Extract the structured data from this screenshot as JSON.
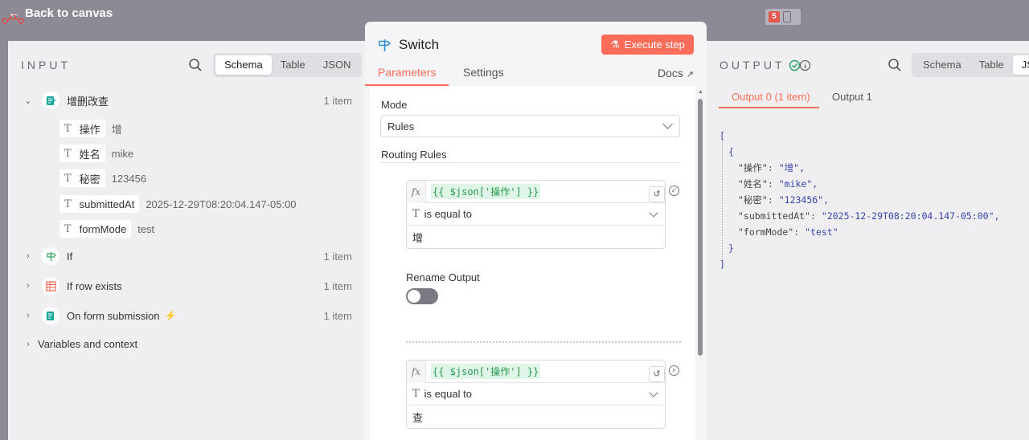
{
  "topbar": {
    "back_label": "Back to canvas"
  },
  "input": {
    "title": "INPUT",
    "view_options": [
      "Schema",
      "Table",
      "JSON"
    ],
    "active_view": "Schema",
    "nodes": [
      {
        "name": "增删改查",
        "count": "1 item",
        "expanded": true
      },
      {
        "name": "If",
        "count": "1 item"
      },
      {
        "name": "If row exists",
        "count": "1 item"
      },
      {
        "name": "On form submission",
        "count": "1 item"
      }
    ],
    "fields": [
      {
        "key": "操作",
        "value": "增"
      },
      {
        "key": "姓名",
        "value": "mike"
      },
      {
        "key": "秘密",
        "value": "123456"
      },
      {
        "key": "submittedAt",
        "value": "2025-12-29T08:20:04.147-05:00"
      },
      {
        "key": "formMode",
        "value": "test"
      }
    ],
    "variables_label": "Variables and context"
  },
  "switch": {
    "title": "Switch",
    "execute_label": "Execute step",
    "tabs": [
      "Parameters",
      "Settings"
    ],
    "docs_label": "Docs",
    "mode_label": "Mode",
    "mode_value": "Rules",
    "routing_label": "Routing Rules",
    "rules": [
      {
        "fx": "fx",
        "expression": "{{ $json['操作'] }}",
        "operator": "is equal to",
        "value": "增"
      },
      {
        "fx": "fx",
        "expression": "{{ $json['操作'] }}",
        "operator": "is equal to",
        "value": "查"
      }
    ],
    "rename_output_label": "Rename Output",
    "rename_output_on": false
  },
  "output": {
    "title": "OUTPUT",
    "view_options": [
      "Schema",
      "Table",
      "JS"
    ],
    "active_view": "JS",
    "tabs": [
      "Output 0 (1 item)",
      "Output 1"
    ],
    "json_lines": [
      {
        "k": "\"操作\"",
        "v": "\"增\","
      },
      {
        "k": "\"姓名\"",
        "v": "\"mike\","
      },
      {
        "k": "\"秘密\"",
        "v": "\"123456\","
      },
      {
        "k": "\"submittedAt\"",
        "v": "\"2025-12-29T08:20:04.147-05:00\","
      },
      {
        "k": "\"formMode\"",
        "v": "\"test\""
      }
    ]
  },
  "colors": {
    "accent": "#ff6d5a",
    "success": "#29a36a",
    "code_bg": "#dff5e7",
    "code_fg": "#2a9950"
  }
}
